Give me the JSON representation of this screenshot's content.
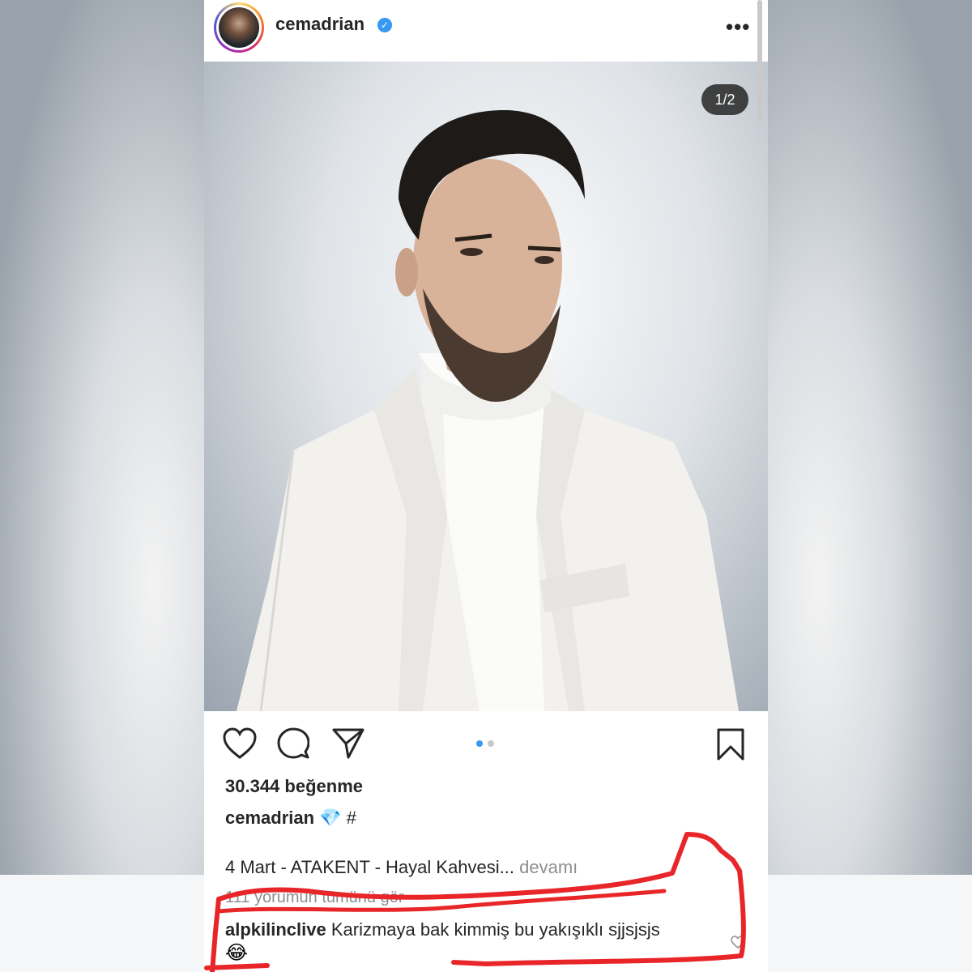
{
  "post": {
    "username": "cemadrian",
    "verified_badge": "✓",
    "more_icon": "•••",
    "image_counter": "1/2",
    "likes": "30.344 beğenme",
    "caption_user": "cemadrian",
    "caption_emoji": "💎",
    "caption_hashtag": "#",
    "caption_line": "4 Mart - ATAKENT - Hayal Kahvesi...",
    "caption_more": "devamı",
    "view_comments": "111 yorumun tümünü gör",
    "comment_user": "alpkilinclive",
    "comment_text": "Karizmaya bak  kimmiş bu yakışıklı sjjsjsjs",
    "comment_emoji": "😂"
  },
  "colors": {
    "verified_blue": "#3897f0",
    "annotation_red": "#e8262a"
  },
  "icons": {
    "like": "heart-icon",
    "comment": "comment-bubble-icon",
    "share": "paper-plane-icon",
    "save": "bookmark-icon",
    "more": "ellipsis-icon"
  }
}
